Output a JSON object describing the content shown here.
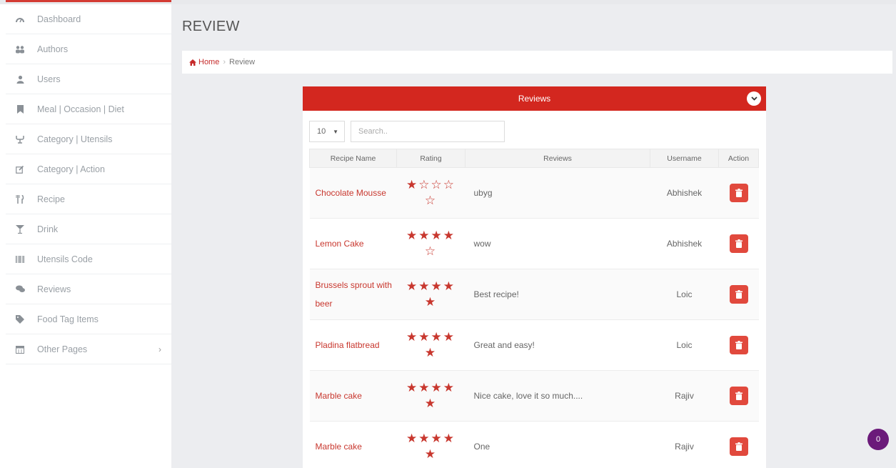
{
  "page": {
    "title": "REVIEW"
  },
  "breadcrumb": {
    "home": "Home",
    "current": "Review"
  },
  "sidebar": {
    "items": [
      {
        "label": "Dashboard",
        "icon": "dashboard-icon"
      },
      {
        "label": "Authors",
        "icon": "authors-icon"
      },
      {
        "label": "Users",
        "icon": "user-icon"
      },
      {
        "label": "Meal | Occasion | Diet",
        "icon": "bookmark-icon"
      },
      {
        "label": "Category | Utensils",
        "icon": "utensils-icon"
      },
      {
        "label": "Category | Action",
        "icon": "edit-icon"
      },
      {
        "label": "Recipe",
        "icon": "fork-knife-icon"
      },
      {
        "label": "Drink",
        "icon": "glass-icon"
      },
      {
        "label": "Utensils Code",
        "icon": "barcode-icon"
      },
      {
        "label": "Reviews",
        "icon": "comments-icon"
      },
      {
        "label": "Food Tag Items",
        "icon": "tag-icon"
      },
      {
        "label": "Other Pages",
        "icon": "calendar-icon",
        "has_submenu": true
      }
    ]
  },
  "card": {
    "title": "Reviews"
  },
  "controls": {
    "page_size": "10",
    "search_placeholder": "Search.."
  },
  "table": {
    "headers": {
      "recipe": "Recipe Name",
      "rating": "Rating",
      "reviews": "Reviews",
      "username": "Username",
      "action": "Action"
    },
    "rows": [
      {
        "recipe": "Chocolate Mousse",
        "rating": 1,
        "review": "ubyg",
        "username": "Abhishek"
      },
      {
        "recipe": "Lemon Cake",
        "rating": 4,
        "review": "wow",
        "username": "Abhishek"
      },
      {
        "recipe": "Brussels sprout with beer",
        "rating": 5,
        "review": "Best recipe!",
        "username": "Loic"
      },
      {
        "recipe": "Pladina flatbread",
        "rating": 5,
        "review": "Great and easy!",
        "username": "Loic"
      },
      {
        "recipe": "Marble cake",
        "rating": 5,
        "review": "Nice cake, love it so much....",
        "username": "Rajiv"
      },
      {
        "recipe": "Marble cake",
        "rating": 5,
        "review": "One",
        "username": "Rajiv"
      }
    ]
  },
  "notification": {
    "count": "0"
  },
  "colors": {
    "accent": "#d3271f",
    "link": "#c8372e",
    "delete": "#e1493d",
    "badge": "#6b1a7a"
  }
}
